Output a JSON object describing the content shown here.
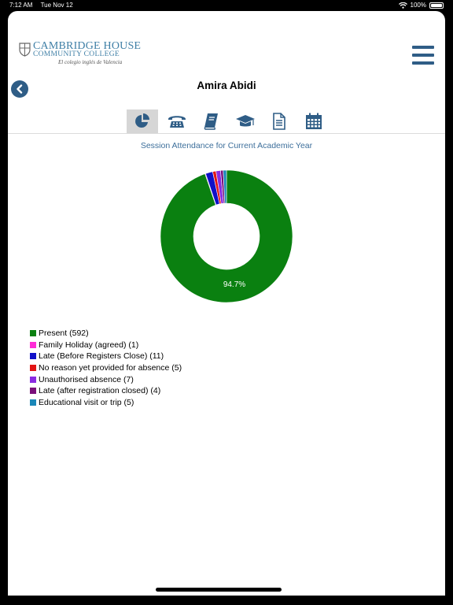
{
  "status_bar": {
    "time": "7:12 AM",
    "date": "Tue Nov 12",
    "battery": "100%"
  },
  "header": {
    "logo_line1": "CAMBRIDGE HOUSE",
    "logo_line2": "COMMUNITY COLLEGE",
    "logo_line3": "El colegio inglés de Valencia",
    "student_name": "Amira Abidi"
  },
  "tabs": [
    {
      "name": "attendance",
      "icon": "pie-chart-icon",
      "active": true
    },
    {
      "name": "contacts",
      "icon": "telephone-icon",
      "active": false
    },
    {
      "name": "homework",
      "icon": "book-icon",
      "active": false
    },
    {
      "name": "grades",
      "icon": "graduation-cap-icon",
      "active": false
    },
    {
      "name": "reports",
      "icon": "document-icon",
      "active": false
    },
    {
      "name": "calendar",
      "icon": "calendar-icon",
      "active": false
    }
  ],
  "chart_data": {
    "type": "pie",
    "title": "Session Attendance for Current Academic Year",
    "donut": true,
    "slice_label": "94.7%",
    "slices": [
      {
        "label": "Present (592)",
        "value": 592,
        "color": "#0a8010"
      },
      {
        "label": "Family Holiday (agreed) (1)",
        "value": 1,
        "color": "#ff2bd6"
      },
      {
        "label": "Late (Before Registers Close) (11)",
        "value": 11,
        "color": "#1010c8"
      },
      {
        "label": "No reason yet provided for absence (5)",
        "value": 5,
        "color": "#e21414"
      },
      {
        "label": "Unauthorised absence (7)",
        "value": 7,
        "color": "#8a2be2"
      },
      {
        "label": "Late (after registration closed) (4)",
        "value": 4,
        "color": "#7a0f7a"
      },
      {
        "label": "Educational visit or trip (5)",
        "value": 5,
        "color": "#1a87b8"
      }
    ]
  }
}
